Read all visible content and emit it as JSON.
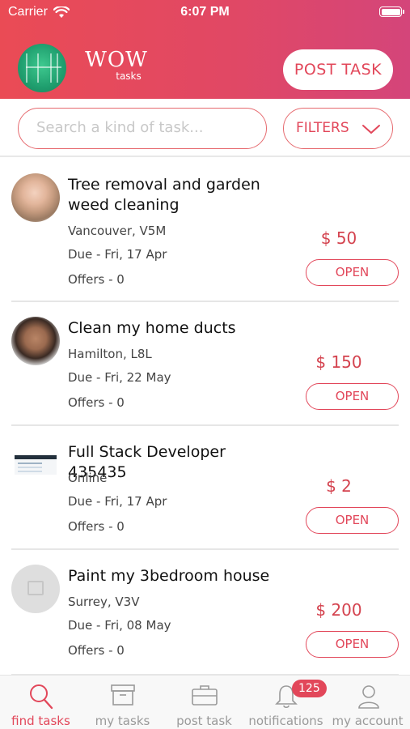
{
  "status_bar": {
    "carrier": "Carrier",
    "time": "6:07 PM"
  },
  "header": {
    "brand_main": "WOW",
    "brand_sub": "tasks",
    "post_task_label": "POST TASK"
  },
  "search": {
    "placeholder": "Search a kind of task...",
    "filters_label": "FILTERS"
  },
  "tasks": [
    {
      "title": "Tree removal and garden weed cleaning",
      "location": "Vancouver, V5M",
      "due": "Due - Fri, 17 Apr",
      "offers": "Offers - 0",
      "price": "$ 50",
      "status": "OPEN"
    },
    {
      "title": "Clean my home ducts",
      "location": "Hamilton, L8L",
      "due": "Due - Fri, 22 May",
      "offers": "Offers - 0",
      "price": "$ 150",
      "status": "OPEN"
    },
    {
      "title": "Full Stack Developer 435435",
      "location": "Online",
      "due": "Due - Fri, 17 Apr",
      "offers": "Offers - 0",
      "price": "$ 2",
      "status": "OPEN"
    },
    {
      "title": "Paint my 3bedroom house",
      "location": "Surrey, V3V",
      "due": "Due - Fri, 08 May",
      "offers": "Offers - 0",
      "price": "$ 200",
      "status": "OPEN"
    }
  ],
  "tabbar": {
    "tabs": [
      {
        "label": "find tasks",
        "icon": "search-icon",
        "active": true
      },
      {
        "label": "my tasks",
        "icon": "archive-box-icon"
      },
      {
        "label": "post task",
        "icon": "briefcase-icon"
      },
      {
        "label": "notifications",
        "icon": "bell-icon"
      },
      {
        "label": "my account",
        "icon": "user-icon"
      }
    ],
    "notifications_badge": "125"
  },
  "colors": {
    "accent": "#e2475a",
    "header_gradient_start": "#ea4b55",
    "header_gradient_end": "#d4457a",
    "price": "#d4434f"
  }
}
